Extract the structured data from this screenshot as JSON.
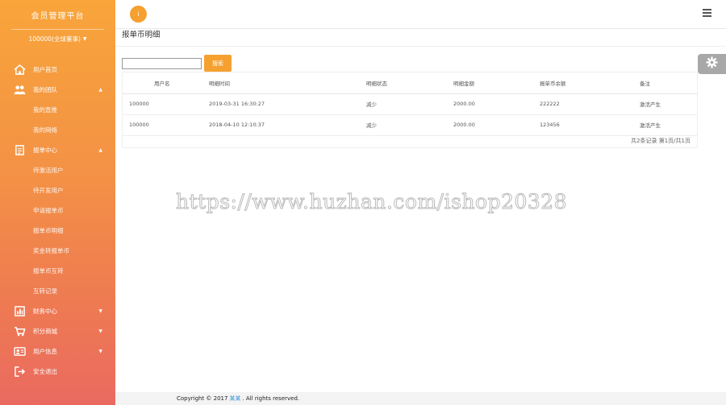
{
  "sidebar": {
    "brand": "会员管理平台",
    "account": "100000(全球董事)",
    "groups": [
      {
        "label": "用户首页",
        "icon": "home-icon"
      },
      {
        "label": "我的团队",
        "icon": "team-icon",
        "children": [
          "我的直推",
          "我的网络"
        ]
      },
      {
        "label": "报单中心",
        "icon": "document-icon",
        "children": [
          "待激活用户",
          "待开发用户",
          "申请报单币",
          "报单币明细",
          "奖金转报单币",
          "报单币互转",
          "互转记录"
        ]
      },
      {
        "label": "财务中心",
        "icon": "finance-icon"
      },
      {
        "label": "积分商城",
        "icon": "mall-icon"
      },
      {
        "label": "用户信息",
        "icon": "user-icon"
      },
      {
        "label": "安全退出",
        "icon": "exit-icon"
      }
    ]
  },
  "topbar": {
    "avatar_text": "i"
  },
  "page": {
    "title": "报单币明细",
    "search_button": "搜索",
    "search_placeholder": ""
  },
  "table": {
    "columns": [
      "用户名",
      "明细时间",
      "明细状态",
      "明细金额",
      "报单币余额",
      "备注"
    ],
    "rows": [
      [
        "100000",
        "2019-03-31 16:30:27",
        "减少",
        "2000.00",
        "222222",
        "激活产生"
      ],
      [
        "100000",
        "2018-04-10 12:10:37",
        "减少",
        "2000.00",
        "123456",
        "激活产生"
      ]
    ],
    "pager": "共2条记录 第1页/共1页"
  },
  "watermark": "https://www.huzhan.com/ishop20328",
  "footer": {
    "prefix": "Copyright © 2017",
    "brand": "某某",
    "suffix": ". All rights reserved."
  }
}
